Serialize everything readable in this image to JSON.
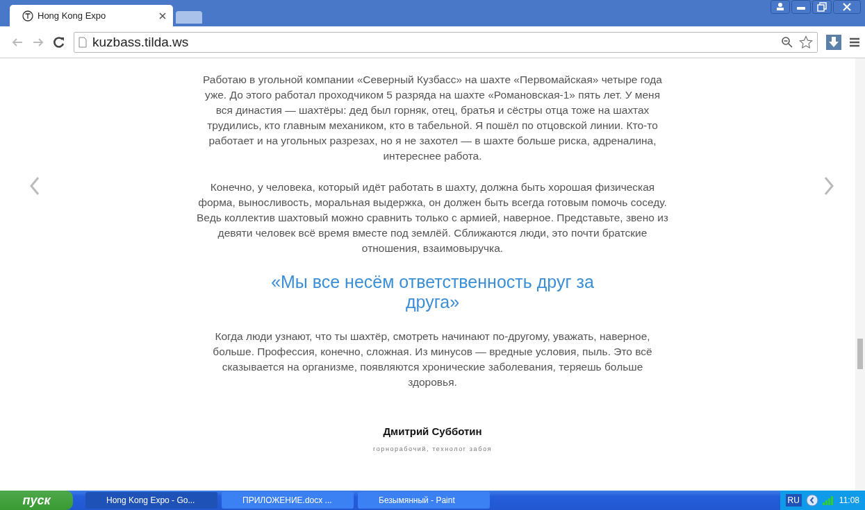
{
  "browser": {
    "tabs": [
      {
        "title": "Hong Kong Expo",
        "selected": true
      }
    ],
    "address": "kuzbass.tilda.ws"
  },
  "article": {
    "paragraphs": [
      "Работаю в угольной компании «Северный Кузбасс» на шахте «Первомайская» четыре года уже. До этого работал проходчиком 5 разряда на шахте «Романовская-1» пять лет. У меня вся династия — шахтёры: дед был горняк, отец, братья и сёстры отца тоже на шахтах трудились, кто главным механиком, кто в табельной. Я пошёл по отцовской линии. Кто-то работает и на угольных разрезах, но я не захотел — в шахте больше риска, адреналина, интереснее работа.",
      "Конечно, у человека, который идёт работать в шахту, должна быть хорошая физическая форма, выносливость, моральная выдержка, он должен быть всегда готовым помочь соседу. Ведь коллектив шахтовый можно сравнить только с армией, наверное. Представьте, звено из девяти человек всё время вместе под землёй. Сближаются люди, это почти братские отношения, взаимовыручка."
    ],
    "quote": "«Мы все несём ответственность друг за друга»",
    "closing": "Когда люди узнают, что ты шахтёр, смотреть начинают по-другому, уважать, наверное, больше. Профессия, конечно, сложная. Из минусов — вредные условия, пыль. Это всё сказывается на организме, появляются хронические заболевания, теряешь больше здоровья.",
    "author": "Дмитрий Субботин",
    "role": "горнорабочий, технолог забоя"
  },
  "taskbar": {
    "start": "пуск",
    "items": [
      {
        "label": "Hong Kong Expo - Go...",
        "selected": true
      },
      {
        "label": "ПРИЛОЖЕНИЕ.docx ...",
        "selected": false
      },
      {
        "label": "Безымянный - Paint",
        "selected": false
      }
    ],
    "language": "RU",
    "clock": "11:08"
  }
}
